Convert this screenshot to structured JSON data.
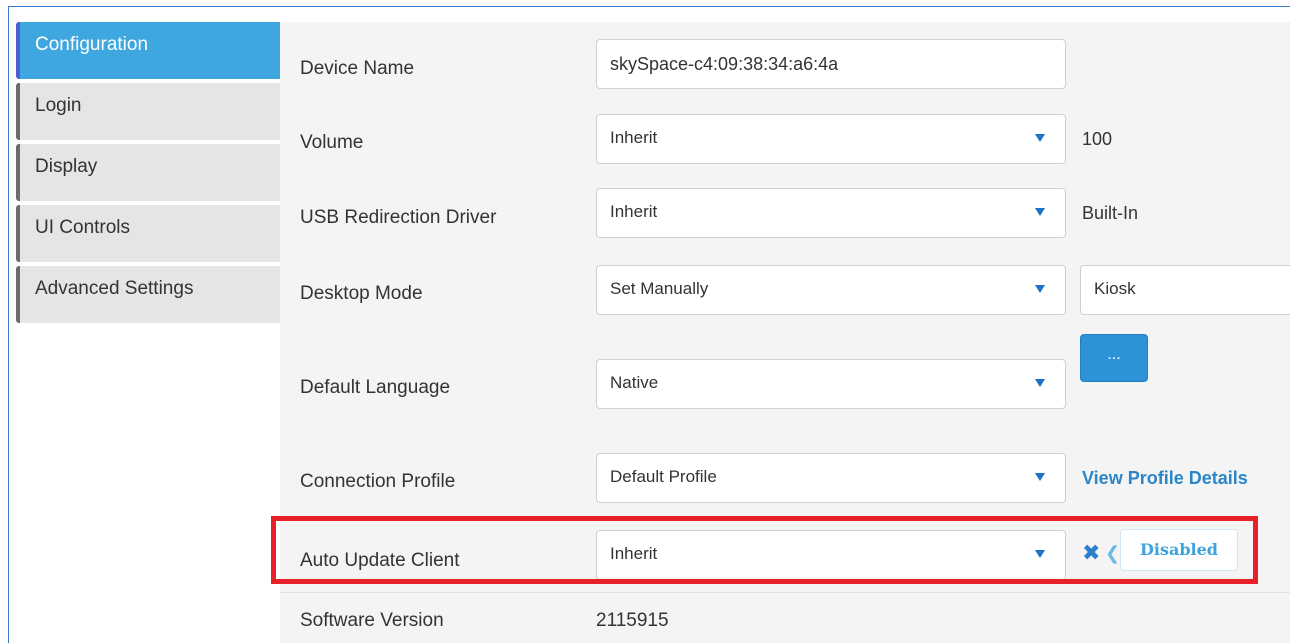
{
  "sidebar": {
    "items": [
      {
        "label": "Configuration",
        "active": true
      },
      {
        "label": "Login",
        "active": false
      },
      {
        "label": "Display",
        "active": false
      },
      {
        "label": "UI Controls",
        "active": false
      },
      {
        "label": "Advanced Settings",
        "active": false
      }
    ]
  },
  "form": {
    "device_name": {
      "label": "Device Name",
      "value": "skySpace-c4:09:38:34:a6:4a"
    },
    "volume": {
      "label": "Volume",
      "value": "Inherit",
      "extra": "100"
    },
    "usb": {
      "label": "USB Redirection Driver",
      "value": "Inherit",
      "extra": "Built-In"
    },
    "desktop_mode": {
      "label": "Desktop Mode",
      "value": "Set Manually",
      "extra": "Kiosk"
    },
    "default_language": {
      "label": "Default Language",
      "value": "Native",
      "button": "..."
    },
    "connection_profile": {
      "label": "Connection Profile",
      "value": "Default Profile",
      "link": "View Profile Details"
    },
    "auto_update": {
      "label": "Auto Update Client",
      "value": "Inherit",
      "badge": "Disabled",
      "icon": "close-icon"
    },
    "software_version": {
      "label": "Software Version",
      "value": "2115915"
    }
  },
  "colors": {
    "accent": "#3fa7e0",
    "highlight": "#e8202a",
    "link": "#2a86c8"
  }
}
